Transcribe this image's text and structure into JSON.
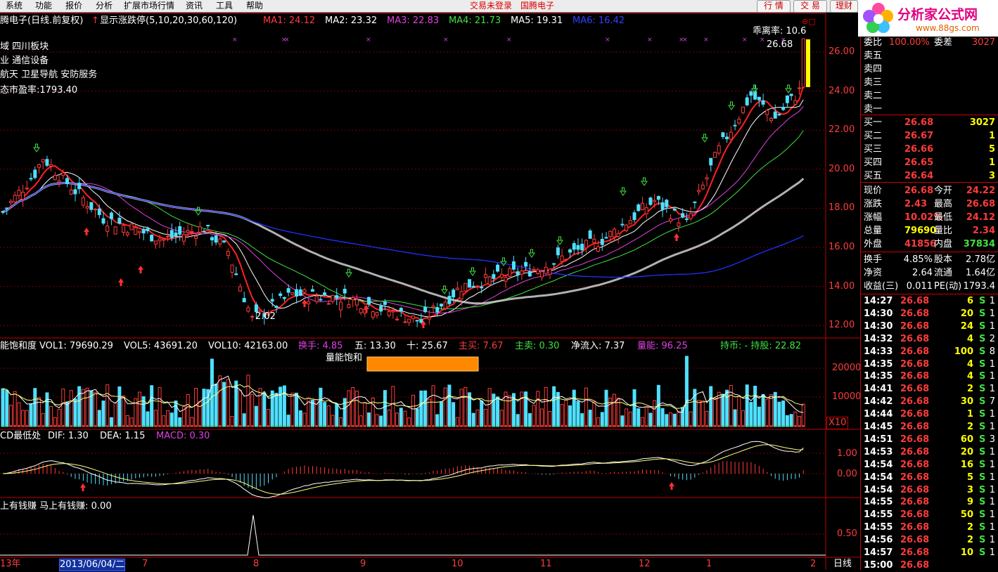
{
  "menu": [
    "系统",
    "功能",
    "报价",
    "分析",
    "扩展市场行情",
    "资讯",
    "工具",
    "帮助"
  ],
  "status": {
    "trade": "交易未登录",
    "stock": "国腾电子"
  },
  "buttons": {
    "quote": "行 情",
    "trade": "交 易",
    "finance": "理财"
  },
  "logo": {
    "text": "分析家公式网",
    "url": "www.88gs.com"
  },
  "main": {
    "title": "腾电子(日线.前复权)",
    "indicator": "显示涨跌停(5,10,20,30,60,120)",
    "ma": [
      {
        "label": "MA1: 24.12",
        "color": "#ff3b3b"
      },
      {
        "label": "MA2: 23.32",
        "color": "#ffffff"
      },
      {
        "label": "MA3: 22.83",
        "color": "#e040e0"
      },
      {
        "label": "MA4: 21.73",
        "color": "#40e040"
      },
      {
        "label": "MA5: 19.31",
        "color": "#ffffff"
      },
      {
        "label": "MA6: 16.42",
        "color": "#3040ff"
      }
    ],
    "info": [
      "域 四川板块",
      "业 通信设备",
      "航天 卫星导航 安防服务",
      "态市盈率:1793.40"
    ],
    "bias": "乖离率: 10.6",
    "last_price": "26.68",
    "low_label": "2.02",
    "y_ticks": [
      "26.00",
      "24.00",
      "22.00",
      "20.00",
      "18.00",
      "16.00",
      "14.00",
      "12.00"
    ]
  },
  "volume": {
    "title": "能饱和度",
    "items": [
      {
        "label": "VOL1: 79690.29",
        "color": "#ffffff"
      },
      {
        "label": "VOL5: 43691.20",
        "color": "#ffffff"
      },
      {
        "label": "VOL10: 42163.00",
        "color": "#ffffff"
      },
      {
        "label": "换手: 4.85",
        "color": "#e040e0"
      },
      {
        "label": "五: 13.30",
        "color": "#ffffff"
      },
      {
        "label": "十: 25.67",
        "color": "#ffffff"
      },
      {
        "label": "主买: 7.67",
        "color": "#ff3b3b"
      },
      {
        "label": "主卖: 0.30",
        "color": "#40e040"
      },
      {
        "label": "净流入: 7.37",
        "color": "#ffffff"
      },
      {
        "label": "量能: 96.25",
        "color": "#e040e0"
      }
    ],
    "hold": "持币: -  持股: 22.82",
    "saturation": "量能饱和",
    "y_ticks": [
      "20000",
      "10000"
    ],
    "unit": "X10"
  },
  "macd": {
    "title": "CD最低处",
    "items": [
      {
        "label": "DIF: 1.30",
        "color": "#ffffff"
      },
      {
        "label": "DEA: 1.15",
        "color": "#ffffff"
      },
      {
        "label": "MACD: 0.30",
        "color": "#e040e0"
      }
    ],
    "y_ticks": [
      "1.00",
      "0.00"
    ]
  },
  "money": {
    "title": "上有钱赚  马上有钱赚: 0.00",
    "y_ticks": [
      "0.50"
    ]
  },
  "x_axis": {
    "labels": [
      "13年",
      "2013/06/04/二",
      "7",
      "8",
      "9",
      "10",
      "11",
      "12",
      "1",
      "2"
    ],
    "period": "日线"
  },
  "quote": {
    "ratio_label": "委比",
    "ratio_value": "100.00%",
    "diff_label": "委差",
    "diff_value": "3027",
    "asks": [
      "卖五",
      "卖四",
      "卖三",
      "卖二",
      "卖一"
    ],
    "bids": [
      {
        "label": "买一",
        "price": "26.68",
        "vol": "3027"
      },
      {
        "label": "买二",
        "price": "26.67",
        "vol": "1"
      },
      {
        "label": "买三",
        "price": "26.66",
        "vol": "5"
      },
      {
        "label": "买四",
        "price": "26.65",
        "vol": "1"
      },
      {
        "label": "买五",
        "price": "26.64",
        "vol": "3"
      }
    ],
    "stats": [
      {
        "l1": "现价",
        "v1": "26.68",
        "c1": "#ff3b3b",
        "l2": "今开",
        "v2": "24.22",
        "c2": "#ff3b3b"
      },
      {
        "l1": "涨跌",
        "v1": "2.43",
        "c1": "#ff3b3b",
        "l2": "最高",
        "v2": "26.68",
        "c2": "#ff3b3b"
      },
      {
        "l1": "涨幅",
        "v1": "10.02%",
        "c1": "#ff3b3b",
        "l2": "最低",
        "v2": "24.12",
        "c2": "#ff3b3b"
      },
      {
        "l1": "总量",
        "v1": "79690",
        "c1": "#ffff00",
        "l2": "量比",
        "v2": "2.34",
        "c2": "#ff3b3b"
      },
      {
        "l1": "外盘",
        "v1": "41856",
        "c1": "#ff3b3b",
        "l2": "内盘",
        "v2": "37834",
        "c2": "#40e040"
      }
    ],
    "stats2": [
      {
        "l1": "换手",
        "v1": "4.85%",
        "l2": "股本",
        "v2": "2.78亿"
      },
      {
        "l1": "净资",
        "v1": "2.64",
        "l2": "流通",
        "v2": "1.64亿"
      },
      {
        "l1": "收益(三)",
        "v1": "0.011",
        "l2": "PE(动)",
        "v2": "1793.4"
      }
    ]
  },
  "ticks": [
    {
      "time": "14:27",
      "price": "26.68",
      "vol": "6",
      "side": "S",
      "n": "1"
    },
    {
      "time": "14:30",
      "price": "26.68",
      "vol": "20",
      "side": "S",
      "n": "1"
    },
    {
      "time": "14:30",
      "price": "26.68",
      "vol": "24",
      "side": "S",
      "n": "1"
    },
    {
      "time": "14:32",
      "price": "26.68",
      "vol": "4",
      "side": "S",
      "n": "2"
    },
    {
      "time": "14:33",
      "price": "26.68",
      "vol": "100",
      "side": "S",
      "n": "8"
    },
    {
      "time": "14:35",
      "price": "26.68",
      "vol": "4",
      "side": "S",
      "n": "1"
    },
    {
      "time": "14:35",
      "price": "26.68",
      "vol": "4",
      "side": "S",
      "n": "1"
    },
    {
      "time": "14:41",
      "price": "26.68",
      "vol": "2",
      "side": "S",
      "n": "1"
    },
    {
      "time": "14:42",
      "price": "26.68",
      "vol": "30",
      "side": "S",
      "n": "7"
    },
    {
      "time": "14:44",
      "price": "26.68",
      "vol": "1",
      "side": "S",
      "n": "1"
    },
    {
      "time": "14:45",
      "price": "26.68",
      "vol": "2",
      "side": "S",
      "n": "1"
    },
    {
      "time": "14:51",
      "price": "26.68",
      "vol": "60",
      "side": "S",
      "n": "3"
    },
    {
      "time": "14:53",
      "price": "26.68",
      "vol": "20",
      "side": "S",
      "n": "1"
    },
    {
      "time": "14:54",
      "price": "26.68",
      "vol": "16",
      "side": "S",
      "n": "1"
    },
    {
      "time": "14:54",
      "price": "26.68",
      "vol": "5",
      "side": "S",
      "n": "1"
    },
    {
      "time": "14:54",
      "price": "26.68",
      "vol": "3",
      "side": "S",
      "n": "1"
    },
    {
      "time": "14:55",
      "price": "26.68",
      "vol": "9",
      "side": "S",
      "n": "1"
    },
    {
      "time": "14:55",
      "price": "26.68",
      "vol": "50",
      "side": "S",
      "n": "1"
    },
    {
      "time": "14:55",
      "price": "26.68",
      "vol": "2",
      "side": "S",
      "n": "1"
    },
    {
      "time": "14:56",
      "price": "26.68",
      "vol": "2",
      "side": "S",
      "n": "1"
    },
    {
      "time": "14:57",
      "price": "26.68",
      "vol": "10",
      "side": "S",
      "n": "1"
    },
    {
      "time": "15:00",
      "price": "26.68",
      "vol": "",
      "side": "",
      "n": ""
    }
  ],
  "colors": {
    "up": "#ff3b3b",
    "down": "#4fe0ff",
    "grid": "#7a0000",
    "axis": "#c00000"
  }
}
